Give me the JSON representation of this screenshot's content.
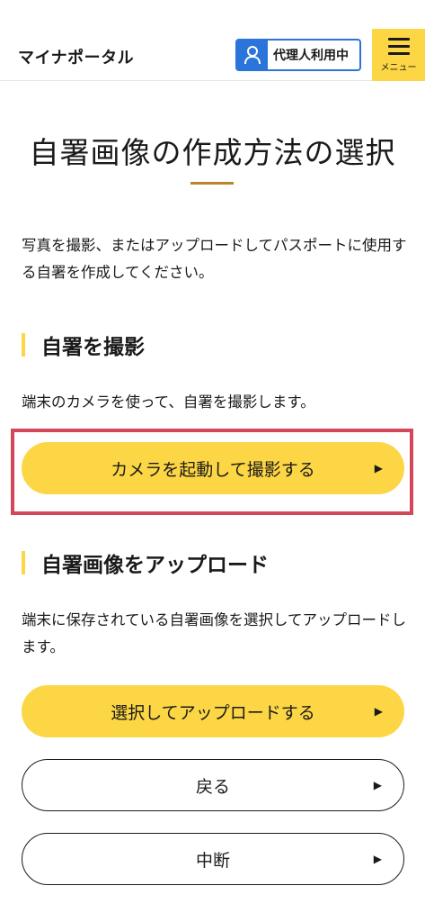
{
  "header": {
    "app_title": "マイナポータル",
    "proxy_label": "代理人利用中",
    "menu_label": "メニュー"
  },
  "page": {
    "title": "自署画像の作成方法の選択",
    "intro": "写真を撮影、またはアップロードしてパスポートに使用する自署を作成してください。"
  },
  "sections": {
    "capture": {
      "heading": "自署を撮影",
      "description": "端末のカメラを使って、自署を撮影します。",
      "button_label": "カメラを起動して撮影する"
    },
    "upload": {
      "heading": "自署画像をアップロード",
      "description": "端末に保存されている自署画像を選択してアップロードします。",
      "button_label": "選択してアップロードする"
    }
  },
  "actions": {
    "back_label": "戻る",
    "abort_label": "中断"
  },
  "icons": {
    "proxy": "person-icon",
    "menu": "hamburger-icon",
    "arrow": "triangle-right-icon"
  },
  "colors": {
    "accent_yellow": "#fcd644",
    "proxy_blue": "#2b74d9",
    "title_underline": "#b8862b",
    "highlight_red": "#d2475a"
  }
}
